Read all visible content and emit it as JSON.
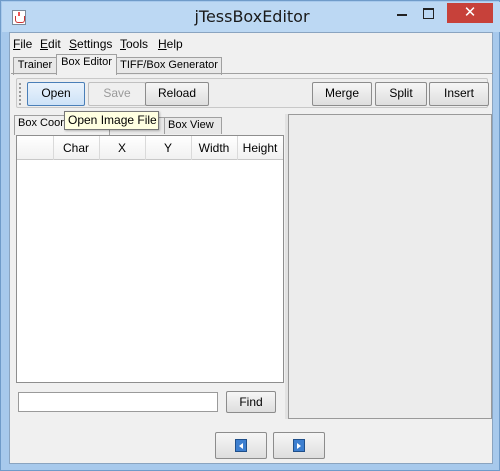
{
  "window": {
    "title": "jTessBoxEditor",
    "minimize_glyph": "",
    "close_glyph": "✕"
  },
  "menubar": {
    "items": [
      {
        "underline": "F",
        "rest": "ile"
      },
      {
        "underline": "E",
        "rest": "dit"
      },
      {
        "underline": "S",
        "rest": "ettings"
      },
      {
        "underline": "T",
        "rest": "ools"
      },
      {
        "underline": "H",
        "rest": "elp"
      }
    ]
  },
  "main_tabs": [
    "Trainer",
    "Box Editor",
    "TIFF/Box Generator"
  ],
  "toolbar": {
    "open": "Open",
    "save": "Save",
    "reload": "Reload",
    "merge": "Merge",
    "split": "Split",
    "insert": "Insert"
  },
  "sub_tabs": [
    "Box Coordinates",
    "Box Data",
    "Box View"
  ],
  "table": {
    "columns": [
      "",
      "Char",
      "X",
      "Y",
      "Width",
      "Height"
    ]
  },
  "find": {
    "label": "Find",
    "value": ""
  },
  "tooltip": {
    "text": "Open Image File"
  },
  "icons": {
    "prev": "prev-page-icon",
    "next": "next-page-icon"
  },
  "colors": {
    "title_bar": "#bcd8f3",
    "close_button": "#c7413a",
    "tooltip_bg": "#ffffe1"
  }
}
